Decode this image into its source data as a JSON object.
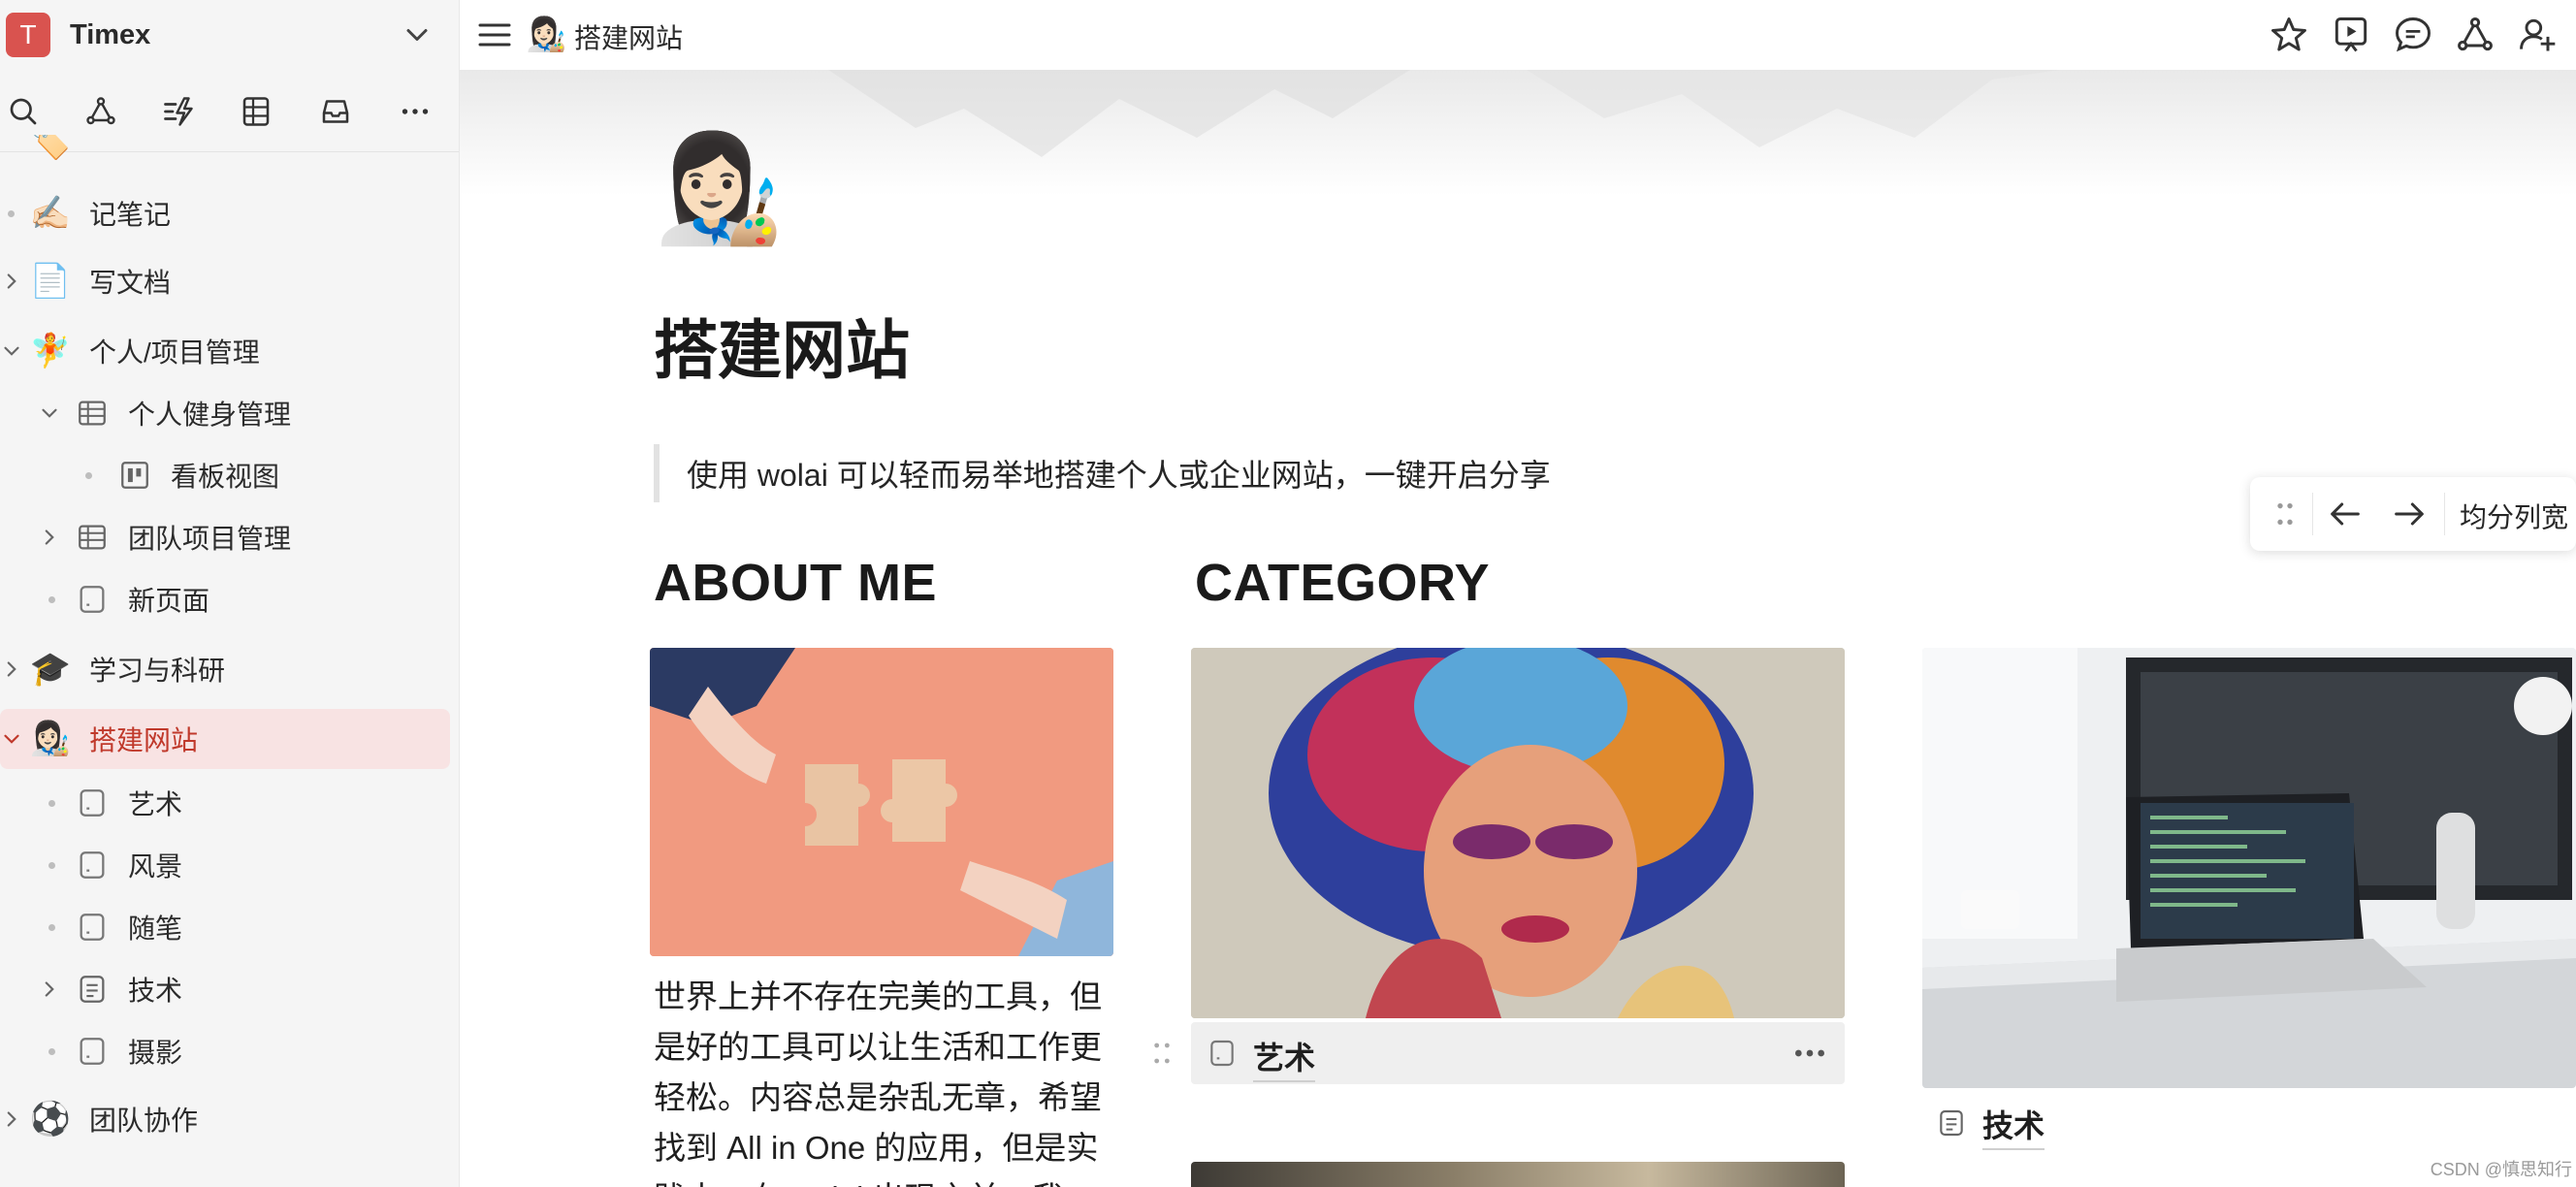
{
  "workspace": {
    "avatar_letter": "T",
    "name": "Timex"
  },
  "sidebar": {
    "tools": [
      "search-icon",
      "graph-icon",
      "lightning-icon",
      "table-icon",
      "inbox-icon",
      "more-icon"
    ],
    "tree": [
      {
        "label": "记笔记",
        "emoji": "✍🏻",
        "kind": "emoji",
        "expander": "dot"
      },
      {
        "label": "写文档",
        "emoji": "📄",
        "kind": "emoji",
        "expander": "collapsed"
      },
      {
        "label": "个人/项目管理",
        "emoji": "🧚",
        "kind": "emoji",
        "expander": "expanded"
      },
      {
        "label": "个人健身管理",
        "kind": "table",
        "expander": "expanded"
      },
      {
        "label": "看板视图",
        "kind": "board",
        "expander": "dot"
      },
      {
        "label": "团队项目管理",
        "kind": "table",
        "expander": "collapsed"
      },
      {
        "label": "新页面",
        "kind": "page",
        "expander": "dot"
      },
      {
        "label": "学习与科研",
        "emoji": "🎓",
        "kind": "emoji",
        "expander": "collapsed"
      },
      {
        "label": "搭建网站",
        "emoji": "👩🏻‍🎨",
        "kind": "emoji",
        "expander": "expanded",
        "selected": true
      },
      {
        "label": "艺术",
        "kind": "page",
        "expander": "dot"
      },
      {
        "label": "风景",
        "kind": "page",
        "expander": "dot"
      },
      {
        "label": "随笔",
        "kind": "page",
        "expander": "dot"
      },
      {
        "label": "技术",
        "kind": "doc",
        "expander": "collapsed"
      },
      {
        "label": "摄影",
        "kind": "page",
        "expander": "dot"
      },
      {
        "label": "团队协作",
        "emoji": "⚽",
        "kind": "emoji",
        "expander": "collapsed"
      }
    ]
  },
  "topbar": {
    "breadcrumb_emoji": "👩🏻‍🎨",
    "breadcrumb_title": "搭建网站",
    "icons": [
      "star-icon",
      "present-icon",
      "comment-icon",
      "graph-icon",
      "add-member-icon"
    ]
  },
  "page": {
    "icon": "👩🏻‍🎨",
    "title": "搭建网站",
    "quote": "使用 wolai 可以轻而易举地搭建个人或企业网站，一键开启分享",
    "about_heading": "ABOUT ME",
    "about_text": "世界上并不存在完美的工具，但是好的工具可以让生活和工作更轻松。内容总是杂乱无章，希望找到 All in One 的应用，但是实践中，在 wolai 出现之前，我",
    "category_heading": "CATEGORY",
    "cards": [
      {
        "title": "艺术"
      },
      {
        "title": "技术"
      }
    ]
  },
  "column_toolbar": {
    "equal_width_label": "均分列宽"
  },
  "watermark": "CSDN @慎思知行"
}
